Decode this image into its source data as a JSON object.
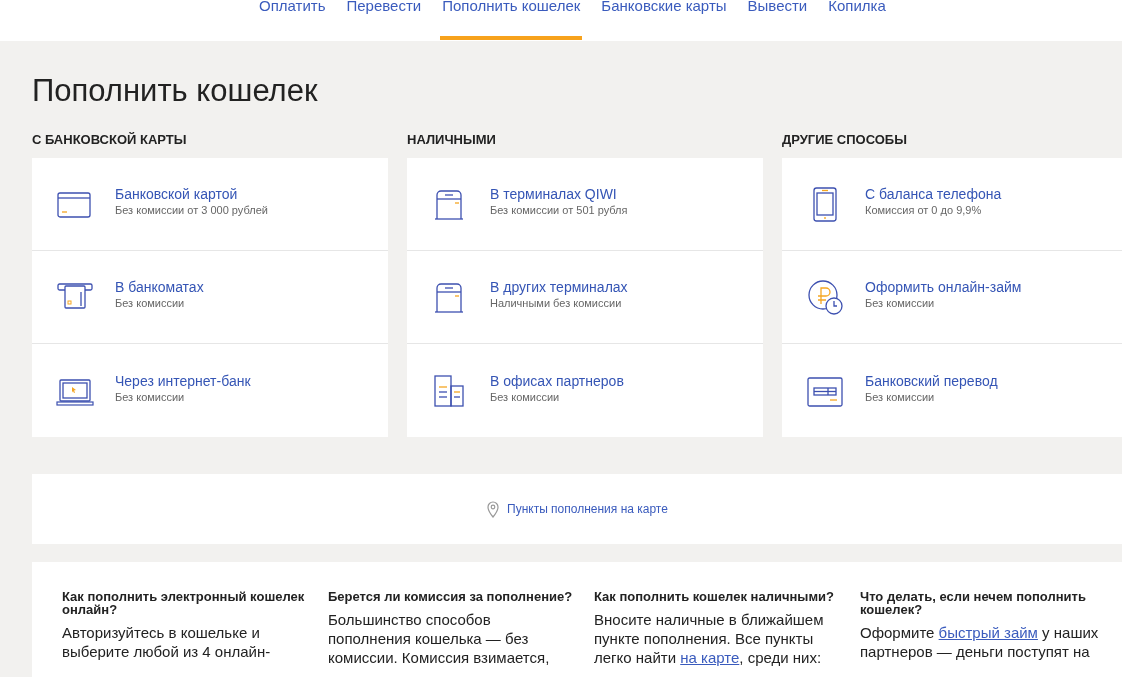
{
  "nav": [
    {
      "label": "Оплатить",
      "selected": false
    },
    {
      "label": "Перевести",
      "selected": false
    },
    {
      "label": "Пополнить кошелек",
      "selected": true
    },
    {
      "label": "Банковские карты",
      "selected": false
    },
    {
      "label": "Вывести",
      "selected": false
    },
    {
      "label": "Копилка",
      "selected": false
    }
  ],
  "title": "Пополнить кошелек",
  "sections": [
    {
      "heading": "С БАНКОВСКОЙ КАРТЫ",
      "items": [
        {
          "kind": "card",
          "title": "Банковской картой",
          "subtitle": "Без комиссии от 3 000 рублей"
        },
        {
          "kind": "atm",
          "title": "В банкоматах",
          "subtitle": "Без комиссии"
        },
        {
          "kind": "laptop",
          "title": "Через интернет-банк",
          "subtitle": "Без комиссии"
        }
      ]
    },
    {
      "heading": "НАЛИЧНЫМИ",
      "items": [
        {
          "kind": "terminal",
          "title": "В терминалах QIWI",
          "subtitle": "Без комиссии от 501 рубля"
        },
        {
          "kind": "terminal",
          "title": "В других терминалах",
          "subtitle": "Наличными без комиссии"
        },
        {
          "kind": "office",
          "title": "В офисах партнеров",
          "subtitle": "Без комиссии"
        }
      ]
    },
    {
      "heading": "ДРУГИЕ СПОСОБЫ",
      "items": [
        {
          "kind": "phone",
          "title": "С баланса телефона",
          "subtitle": "Комиссия от 0 до 9,9%"
        },
        {
          "kind": "loan",
          "title": "Оформить онлайн-займ",
          "subtitle": "Без комиссии"
        },
        {
          "kind": "transfer",
          "title": "Банковский перевод",
          "subtitle": "Без комиссии"
        }
      ]
    }
  ],
  "map_link": "Пункты пополнения на карте",
  "faq": [
    {
      "question": "Как пополнить электронный кошелек онлайн?",
      "answer": [
        {
          "text": "Авторизуйтесь в кошельке и\nвыберите любой из 4 онлайн-",
          "link": false
        }
      ]
    },
    {
      "question": "Берется ли комиссия за пополнение?",
      "answer": [
        {
          "text": "Большинство способов\nпополнения кошелька — без\nкомиссии. Комиссия взимается,",
          "link": false
        }
      ]
    },
    {
      "question": "Как пополнить кошелек наличными?",
      "answer": [
        {
          "text": "Вносите наличные в ближайшем\nпункте пополнения. Все пункты\nлегко найти ",
          "link": false
        },
        {
          "text": "на карте",
          "link": true
        },
        {
          "text": ", среди них:",
          "link": false
        }
      ]
    },
    {
      "question": "Что делать, если нечем пополнить кошелек?",
      "answer": [
        {
          "text": "Оформите ",
          "link": false
        },
        {
          "text": "быстрый займ",
          "link": true
        },
        {
          "text": " у наших\nпартнеров — деньги поступят на",
          "link": false
        }
      ]
    }
  ]
}
